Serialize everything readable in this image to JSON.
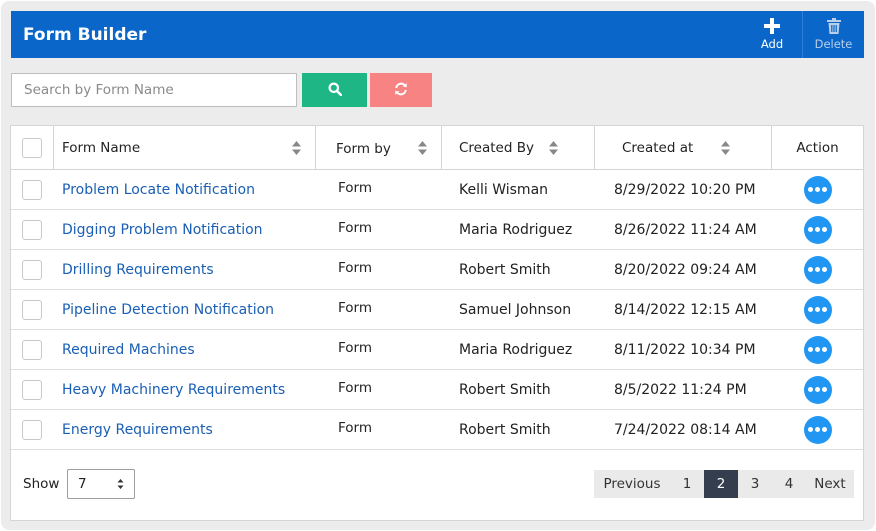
{
  "header": {
    "title": "Form Builder",
    "add_label": "Add",
    "delete_label": "Delete"
  },
  "search": {
    "placeholder": "Search by Form Name",
    "value": ""
  },
  "table": {
    "columns": [
      "Form Name",
      "Form by",
      "Created By",
      "Created at",
      "Action"
    ],
    "rows": [
      {
        "name": "Problem Locate Notification",
        "form_by": "Form",
        "created_by": "Kelli Wisman",
        "created_at": "8/29/2022 10:20 PM"
      },
      {
        "name": "Digging Problem Notification",
        "form_by": "Form",
        "created_by": "Maria Rodriguez",
        "created_at": "8/26/2022 11:24 AM"
      },
      {
        "name": "Drilling Requirements",
        "form_by": "Form",
        "created_by": "Robert Smith",
        "created_at": "8/20/2022 09:24 AM"
      },
      {
        "name": "Pipeline Detection Notification",
        "form_by": "Form",
        "created_by": "Samuel Johnson",
        "created_at": "8/14/2022 12:15 AM"
      },
      {
        "name": "Required Machines",
        "form_by": "Form",
        "created_by": "Maria Rodriguez",
        "created_at": "8/11/2022 10:34 PM"
      },
      {
        "name": "Heavy Machinery Requirements",
        "form_by": "Form",
        "created_by": "Robert Smith",
        "created_at": "8/5/2022 11:24 PM"
      },
      {
        "name": "Energy Requirements",
        "form_by": "Form",
        "created_by": "Robert Smith",
        "created_at": "7/24/2022 08:14 AM"
      }
    ]
  },
  "footer": {
    "show_label": "Show",
    "page_size": "7",
    "pagination": {
      "previous": "Previous",
      "pages": [
        "1",
        "2",
        "3",
        "4"
      ],
      "current": "2",
      "next": "Next"
    }
  },
  "colors": {
    "header": "#0a66c9",
    "search_button": "#1fb685",
    "reset_button": "#f78383",
    "action_button": "#2196f3",
    "link": "#1a5fb5",
    "active_page": "#343e4e"
  }
}
